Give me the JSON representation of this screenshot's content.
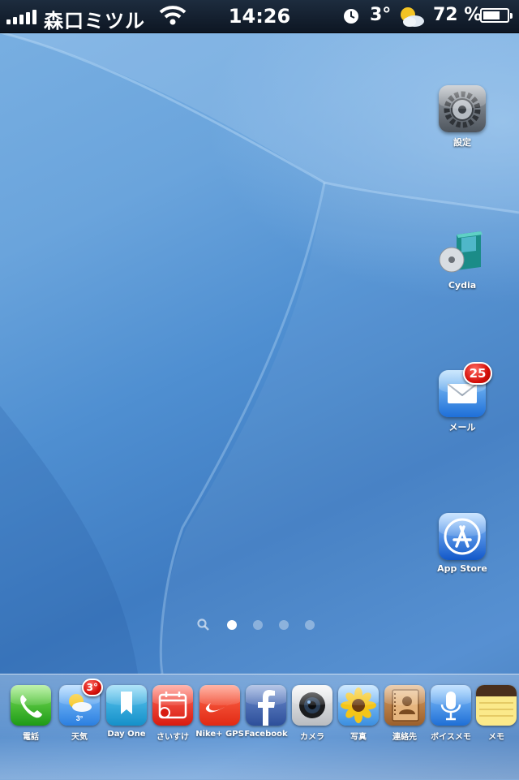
{
  "status": {
    "carrier": "森口ミツル",
    "time": "14:26",
    "temperature": "3°",
    "battery": "72 %",
    "battery_level": 0.72,
    "signal_bars": 5,
    "icons": [
      "signal-icon",
      "wifi-icon",
      "alarm-icon",
      "weather-sun-cloud-icon",
      "battery-icon"
    ]
  },
  "home_apps": [
    {
      "label": "設定",
      "icon": "settings-gear-icon"
    },
    {
      "label": "Cydia",
      "icon": "cydia-box-icon"
    },
    {
      "label": "メール",
      "icon": "mail-envelope-icon",
      "badge": "25"
    },
    {
      "label": "App Store",
      "icon": "app-store-icon"
    }
  ],
  "page_dots": {
    "count": 4,
    "active_index": 0,
    "search_icon": "search-icon"
  },
  "dock": [
    {
      "label": "電話",
      "icon": "phone-icon"
    },
    {
      "label": "天気",
      "icon": "weather-icon",
      "badge": "3°",
      "sublabel": "3°"
    },
    {
      "label": "Day One",
      "icon": "day-one-bookmark-icon"
    },
    {
      "label": "さいすけ",
      "icon": "calendar-icon"
    },
    {
      "label": "Nike+ GPS",
      "icon": "nike-icon"
    },
    {
      "label": "Facebook",
      "icon": "facebook-icon"
    },
    {
      "label": "カメラ",
      "icon": "camera-icon"
    },
    {
      "label": "写真",
      "icon": "photos-sunflower-icon"
    },
    {
      "label": "連絡先",
      "icon": "contacts-book-icon"
    },
    {
      "label": "ボイスメモ",
      "icon": "voice-memo-mic-icon"
    },
    {
      "label": "メモ",
      "icon": "notes-icon"
    }
  ],
  "colors": {
    "wallpaper": "#4f8fd1",
    "badge": "#d5100a",
    "statusbar": "#0d1623"
  }
}
